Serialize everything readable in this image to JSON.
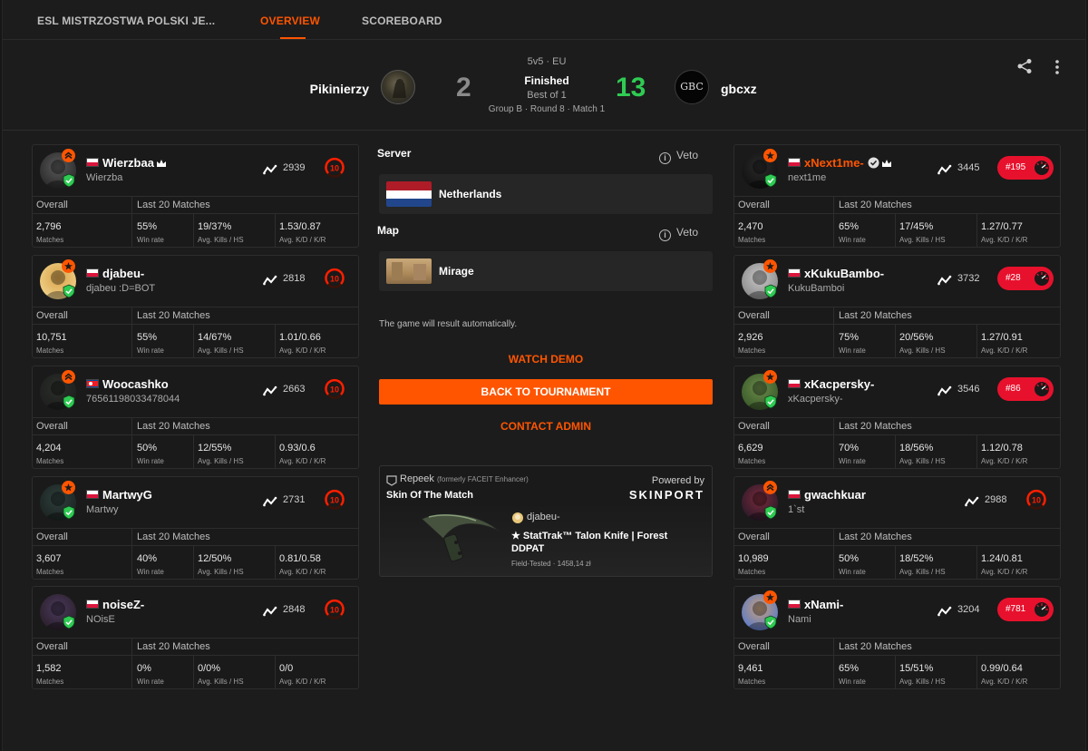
{
  "nav": {
    "tournament": "ESL MISTRZOSTWA POLSKI JE...",
    "overview": "OVERVIEW",
    "scoreboard": "SCOREBOARD"
  },
  "match": {
    "format": "5v5 · EU",
    "status": "Finished",
    "best_of": "Best of 1",
    "stage": "Group B · Round 8 · Match 1",
    "team1": {
      "name": "Pikinierzy",
      "score": "2"
    },
    "team2": {
      "name": "gbcxz",
      "score": "13",
      "logo_text": "GBC"
    }
  },
  "colors": {
    "accent": "#ff5500",
    "win": "#2fcb53",
    "lose": "#8a8a8a",
    "rank_badge": "#e8112d"
  },
  "labels": {
    "overall": "Overall",
    "last20": "Last 20 Matches",
    "matches": "Matches",
    "winrate": "Win rate",
    "kills_hs": "Avg. Kills / HS",
    "kd_kr": "Avg. K/D / K/R"
  },
  "team1_players": [
    {
      "nick": "Wierzbaa",
      "real": "Wierzba",
      "elo": "2939",
      "level": "10",
      "crown": true,
      "matches": "2,796",
      "winrate": "55%",
      "kills_hs": "19/37%",
      "kd_kr": "1.53/0.87",
      "top_icon": "double-chevron",
      "flag": "pl"
    },
    {
      "nick": "djabeu-",
      "real": "djabeu :D=BOT",
      "elo": "2818",
      "level": "10",
      "matches": "10,751",
      "winrate": "55%",
      "kills_hs": "14/67%",
      "kd_kr": "1.01/0.66",
      "top_icon": "star",
      "flag": "pl"
    },
    {
      "nick": "Woocashko",
      "real": "76561198033478044",
      "elo": "2663",
      "level": "10",
      "matches": "4,204",
      "winrate": "50%",
      "kills_hs": "12/55%",
      "kd_kr": "0.93/0.6",
      "top_icon": "double-chevron",
      "flag": "kp"
    },
    {
      "nick": "MartwyG",
      "real": "Martwy",
      "elo": "2731",
      "level": "10",
      "matches": "3,607",
      "winrate": "40%",
      "kills_hs": "12/50%",
      "kd_kr": "0.81/0.58",
      "top_icon": "star",
      "flag": "pl"
    },
    {
      "nick": "noiseZ-",
      "real": "NOisE",
      "elo": "2848",
      "level": "10",
      "matches": "1,582",
      "winrate": "0%",
      "kills_hs": "0/0%",
      "kd_kr": "0/0",
      "top_icon": "none",
      "flag": "pl"
    }
  ],
  "team2_players": [
    {
      "nick": "xNext1me-",
      "real": "next1me",
      "elo": "3445",
      "rank": "#195",
      "verified": true,
      "crown": true,
      "matches": "2,470",
      "winrate": "65%",
      "kills_hs": "17/45%",
      "kd_kr": "1.27/0.77",
      "top_icon": "star",
      "flag": "pl"
    },
    {
      "nick": "xKukuBambo-",
      "real": "KukuBamboi",
      "elo": "3732",
      "rank": "#28",
      "matches": "2,926",
      "winrate": "75%",
      "kills_hs": "20/56%",
      "kd_kr": "1.27/0.91",
      "top_icon": "star",
      "flag": "pl"
    },
    {
      "nick": "xKacpersky-",
      "real": "xKacpersky-",
      "elo": "3546",
      "rank": "#86",
      "matches": "6,629",
      "winrate": "70%",
      "kills_hs": "18/56%",
      "kd_kr": "1.12/0.78",
      "top_icon": "star",
      "flag": "pl"
    },
    {
      "nick": "gwachkuar",
      "real": "1`st",
      "elo": "2988",
      "level": "10",
      "matches": "10,989",
      "winrate": "50%",
      "kills_hs": "18/52%",
      "kd_kr": "1.24/0.81",
      "top_icon": "double-chevron",
      "flag": "pl"
    },
    {
      "nick": "xNami-",
      "real": "Nami",
      "elo": "3204",
      "rank": "#781",
      "matches": "9,461",
      "winrate": "65%",
      "kills_hs": "15/51%",
      "kd_kr": "0.99/0.64",
      "top_icon": "star",
      "flag": "pl"
    }
  ],
  "center": {
    "server_label": "Server",
    "veto": "Veto",
    "server": "Netherlands",
    "map_label": "Map",
    "map": "Mirage",
    "note": "The game will result automatically.",
    "watch_demo": "WATCH DEMO",
    "back": "BACK TO TOURNAMENT",
    "contact": "CONTACT ADMIN",
    "skin": {
      "brand": "Repeek",
      "brand_note": "(formerly FACEIT Enhancer)",
      "title": "Skin Of The Match",
      "powered": "Powered by",
      "sponsor": "SKINPORT",
      "owner": "djabeu-",
      "item_line1": "★ StatTrak™ Talon Knife | Forest",
      "item_line2": "DDPAT",
      "condition": "Field-Tested · 1458,14 zł"
    }
  }
}
